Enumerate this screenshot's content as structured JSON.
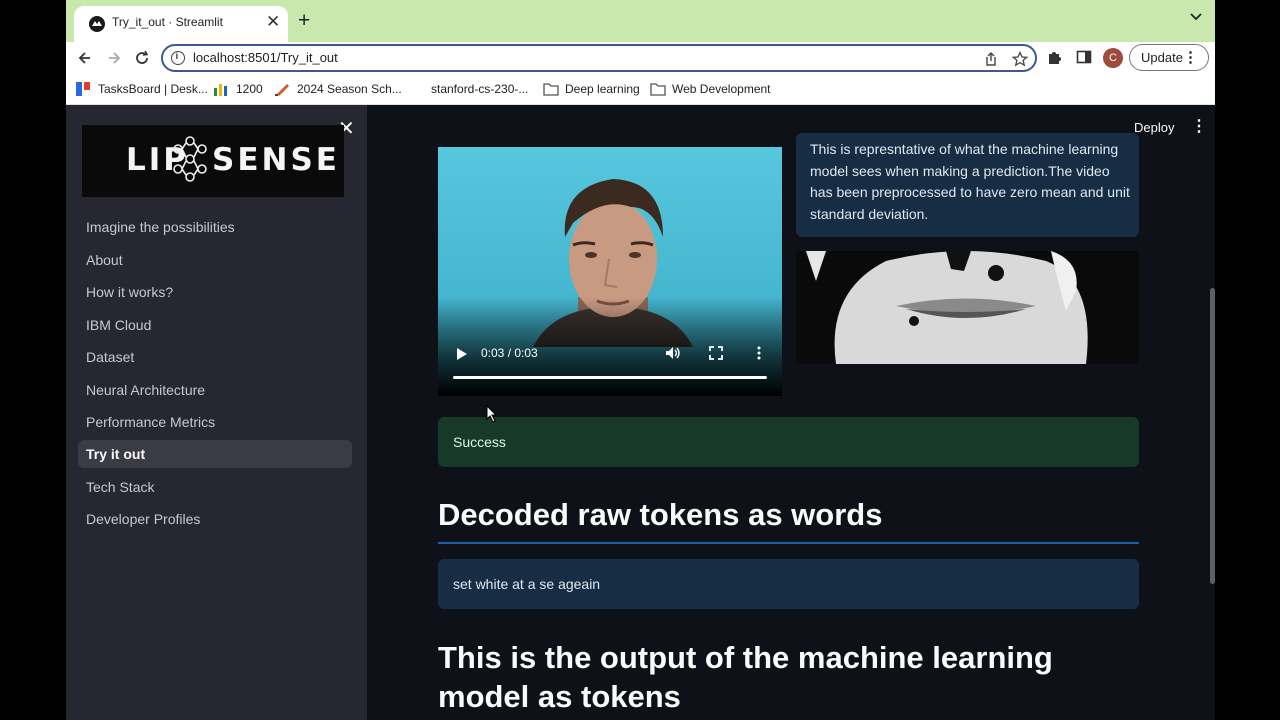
{
  "browser": {
    "tab_title": "Try_it_out · Streamlit",
    "url": "localhost:8501/Try_it_out",
    "update_label": "Update",
    "profile_initial": "C",
    "bookmarks": [
      {
        "label": "TasksBoard | Desk..."
      },
      {
        "label": "1200"
      },
      {
        "label": "2024 Season Sch..."
      },
      {
        "label": "stanford-cs-230-..."
      },
      {
        "label": "Deep learning"
      },
      {
        "label": "Web Development"
      }
    ]
  },
  "header": {
    "deploy_label": "Deploy"
  },
  "sidebar": {
    "logo_left": "LIP",
    "logo_right": "SENSE",
    "items": [
      {
        "label": "Imagine the possibilities",
        "active": false
      },
      {
        "label": "About",
        "active": false
      },
      {
        "label": "How it works?",
        "active": false
      },
      {
        "label": "IBM Cloud",
        "active": false
      },
      {
        "label": "Dataset",
        "active": false
      },
      {
        "label": "Neural Architecture",
        "active": false
      },
      {
        "label": "Performance Metrics",
        "active": false
      },
      {
        "label": "Try it out",
        "active": true
      },
      {
        "label": "Tech Stack",
        "active": false
      },
      {
        "label": "Developer Profiles",
        "active": false
      }
    ]
  },
  "main": {
    "video": {
      "time": "0:03 / 0:03",
      "progress": 1.0
    },
    "info_text": "This is represntative of what the machine learning model sees when making a prediction.The video has been preprocessed to have zero mean and unit standard deviation.",
    "success_text": "Success",
    "decoded_heading": "Decoded raw tokens as words",
    "decoded_text": "set white at a se ageain",
    "output_heading": "This is the output of the machine learning model as tokens"
  },
  "colors": {
    "accent_divider": "#1c5fa8",
    "success_bg": "#173928",
    "info_bg": "#172d43",
    "tabstrip": "#c9e8ae"
  }
}
